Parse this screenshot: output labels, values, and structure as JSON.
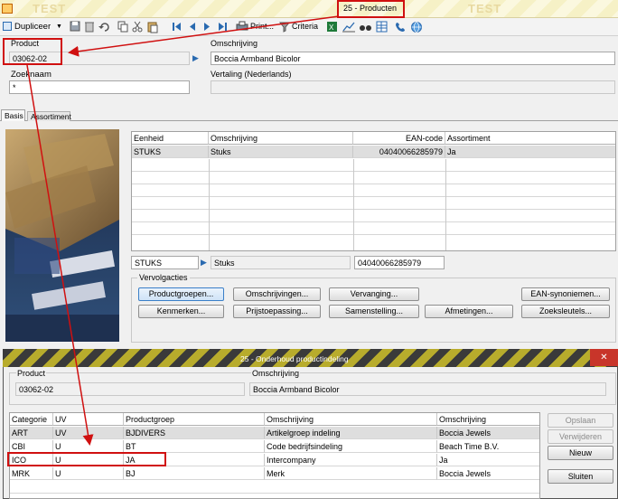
{
  "window_title": "25 - Producten",
  "watermark": "TEST",
  "toolbar": {
    "duplicate_label": "Dupliceer",
    "print_label": "Print...",
    "criteria_label": "Criteria"
  },
  "header": {
    "product_label": "Product",
    "product_value": "03062-02",
    "description_label": "Omschrijving",
    "description_value": "Boccia Armband Bicolor",
    "search_label": "Zoeknaam",
    "search_value": "*",
    "translation_label": "Vertaling (Nederlands)",
    "translation_value": ""
  },
  "tabs": [
    "Basis",
    "Assortiment"
  ],
  "units_grid": {
    "columns": [
      "Eenheid",
      "Omschrijving",
      "EAN-code",
      "Assortiment"
    ],
    "rows": [
      [
        "STUKS",
        "Stuks",
        "04040066285979",
        "Ja"
      ]
    ]
  },
  "unit_detail": {
    "unit": "STUKS",
    "description": "Stuks",
    "ean": "04040066285979"
  },
  "follow_actions": {
    "legend": "Vervolgacties",
    "buttons": [
      "Productgroepen...",
      "Omschrijvingen...",
      "Vervanging...",
      "EAN-synoniemen...",
      "Kenmerken...",
      "Prijstoepassing...",
      "Samenstelling...",
      "Afmetingen...",
      "Zoeksleutels..."
    ]
  },
  "dialog": {
    "title": "25 - Onderhoud productindeling",
    "close_label": "✕",
    "product_label": "Product",
    "product_value": "03062-02",
    "description_label": "Omschrijving",
    "description_value": "Boccia Armband Bicolor",
    "grid_columns": [
      "Categorie",
      "UV",
      "Productgroep",
      "Omschrijving",
      "Omschrijving"
    ],
    "grid_rows": [
      [
        "ART",
        "UV",
        "BJDIVERS",
        "Artikelgroep indeling",
        "Boccia Jewels"
      ],
      [
        "CBI",
        "U",
        "BT",
        "Code bedrijfsindeling",
        "Beach Time B.V."
      ],
      [
        "ICO",
        "U",
        "JA",
        "Intercompany",
        "Ja"
      ],
      [
        "MRK",
        "U",
        "BJ",
        "Merk",
        "Boccia Jewels"
      ]
    ],
    "buttons": {
      "save": "Opslaan",
      "delete": "Verwijderen",
      "new": "Nieuw",
      "close": "Sluiten"
    }
  },
  "colors": {
    "annotation_red": "#d01010",
    "stripe_yellow": "#f6f1c6",
    "selected_row": "#dedede"
  }
}
